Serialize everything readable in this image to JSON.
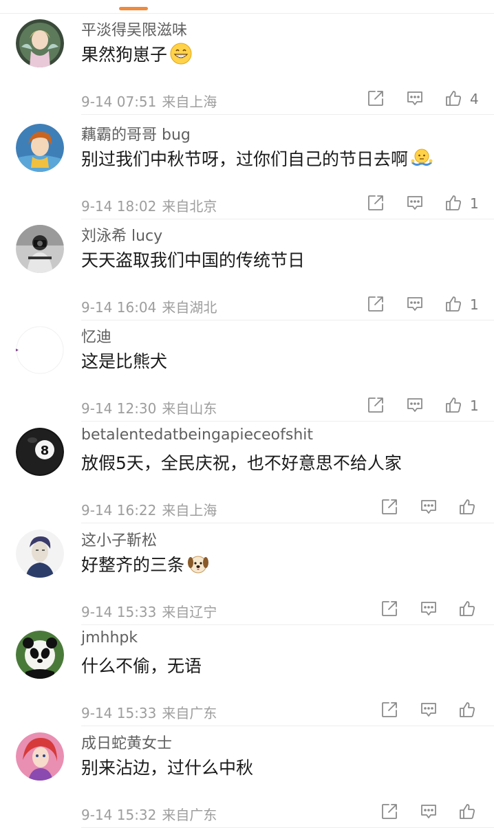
{
  "colors": {
    "accent": "#f08a3c",
    "username": "#5f5f5f",
    "content": "#1a1a1a",
    "meta": "#9d9d9d",
    "icon": "#8a8a8a",
    "divider": "#ededed"
  },
  "icons": {
    "share": "share-icon",
    "comment": "comment-icon",
    "like": "thumbs-up-icon"
  },
  "comments": [
    {
      "username": "平淡得吴限滋味",
      "content": "果然狗崽子",
      "emoji": "grin-emoji",
      "date": "9-14 07:51",
      "location": "来自上海",
      "likes": "4",
      "avatar": "fairy-avatar"
    },
    {
      "username": "藕霸的哥哥 bug",
      "content": "别过我们中秋节呀，过你们自己的节日去啊",
      "emoji": "shrug-emoji",
      "date": "9-14 18:02",
      "location": "来自北京",
      "likes": "1",
      "avatar": "anime-avatar"
    },
    {
      "username": "刘泳希 lucy",
      "content": "天天盗取我们中国的传统节日",
      "emoji": "",
      "date": "9-14 16:04",
      "location": "来自湖北",
      "likes": "1",
      "avatar": "photographer-avatar"
    },
    {
      "username": "忆迪",
      "content": "这是比熊犬",
      "emoji": "",
      "date": "9-14 12:30",
      "location": "来自山东",
      "likes": "1",
      "avatar": "blank-avatar"
    },
    {
      "username": "betalentedatbeingapieceofshit",
      "content": "放假5天，全民庆祝，也不好意思不给人家",
      "emoji": "",
      "date": "9-14 16:22",
      "location": "来自上海",
      "likes": "",
      "avatar": "eight-ball-avatar"
    },
    {
      "username": "这小子靳松",
      "content": "好整齐的三条",
      "emoji": "dog-emoji",
      "date": "9-14 15:33",
      "location": "来自辽宁",
      "likes": "",
      "avatar": "sketch-man-avatar"
    },
    {
      "username": "jmhhpk",
      "content": "什么不偷，无语",
      "emoji": "",
      "date": "9-14 15:33",
      "location": "来自广东",
      "likes": "",
      "avatar": "panda-avatar"
    },
    {
      "username": "成日蛇黄女士",
      "content": "别来沾边，过什么中秋",
      "emoji": "",
      "date": "9-14 15:32",
      "location": "来自广东",
      "likes": "",
      "avatar": "mermaid-avatar"
    }
  ]
}
